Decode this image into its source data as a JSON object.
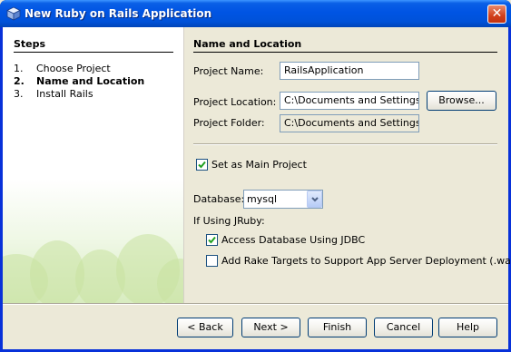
{
  "window": {
    "title": "New Ruby on Rails Application",
    "icon": "ruby-cube-icon",
    "close_label": "✕"
  },
  "steps": {
    "title": "Steps",
    "items": [
      {
        "num": "1.",
        "label": "Choose Project",
        "current": false
      },
      {
        "num": "2.",
        "label": "Name and Location",
        "current": true
      },
      {
        "num": "3.",
        "label": "Install Rails",
        "current": false
      }
    ]
  },
  "form": {
    "section_title": "Name and Location",
    "project_name_label": "Project Name:",
    "project_name_value": "RailsApplication",
    "project_location_label": "Project Location:",
    "project_location_value": "C:\\Documents and Settings\\All",
    "browse_label": "Browse...",
    "project_folder_label": "Project Folder:",
    "project_folder_value": "C:\\Documents and Settings\\All",
    "set_main_label": "Set as Main Project",
    "set_main_checked": true,
    "database_label": "Database:",
    "database_value": "mysql",
    "jruby_label": "If Using JRuby:",
    "jdbc_label": "Access Database Using JDBC",
    "jdbc_checked": true,
    "rake_label": "Add Rake Targets to Support App Server Deployment (.war)",
    "rake_checked": false
  },
  "buttons": {
    "back": "< Back",
    "next": "Next >",
    "finish": "Finish",
    "cancel": "Cancel",
    "help": "Help"
  },
  "colors": {
    "titlebar": "#0054e3",
    "check": "#21a121"
  }
}
